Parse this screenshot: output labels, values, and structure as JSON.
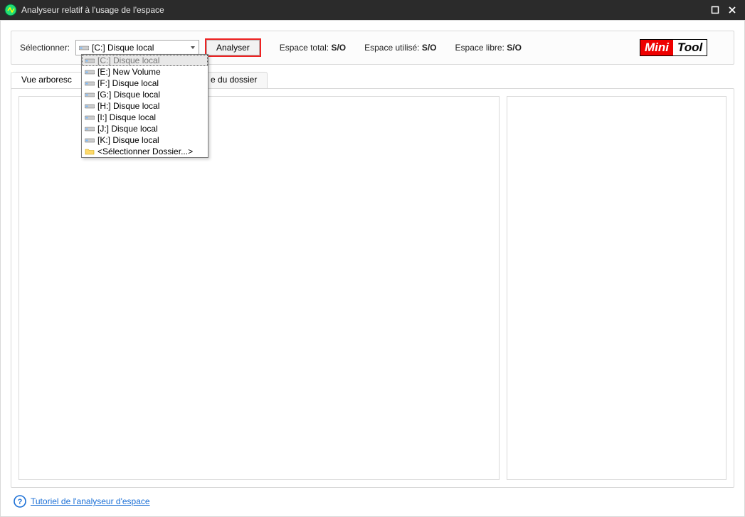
{
  "window": {
    "title": "Analyseur relatif à l'usage de l'espace"
  },
  "toolbar": {
    "select_label": "Sélectionner:",
    "combo_selected": "[C:] Disque local",
    "analyze_label": "Analyser",
    "stats": {
      "total_label": "Espace total:",
      "total_value": "S/O",
      "used_label": "Espace utilisé:",
      "used_value": "S/O",
      "free_label": "Espace libre:",
      "free_value": "S/O"
    },
    "logo": {
      "part1": "Mini",
      "part2": "Tool"
    },
    "dropdown_items": [
      {
        "label": "[C:] Disque local",
        "type": "drive",
        "selected": true
      },
      {
        "label": "[E:] New Volume",
        "type": "drive"
      },
      {
        "label": "[F:] Disque local",
        "type": "drive"
      },
      {
        "label": "[G:] Disque local",
        "type": "drive"
      },
      {
        "label": "[H:] Disque local",
        "type": "drive"
      },
      {
        "label": "[I:] Disque local",
        "type": "drive"
      },
      {
        "label": "[J:] Disque local",
        "type": "drive"
      },
      {
        "label": "[K:] Disque local",
        "type": "drive"
      },
      {
        "label": "<Sélectionner Dossier...>",
        "type": "folder"
      }
    ]
  },
  "tabs": {
    "tree_label": "Vue arboresc",
    "folder_view_fragment": "e du dossier"
  },
  "footer": {
    "link_label": "Tutoriel de l'analyseur d'espace"
  }
}
